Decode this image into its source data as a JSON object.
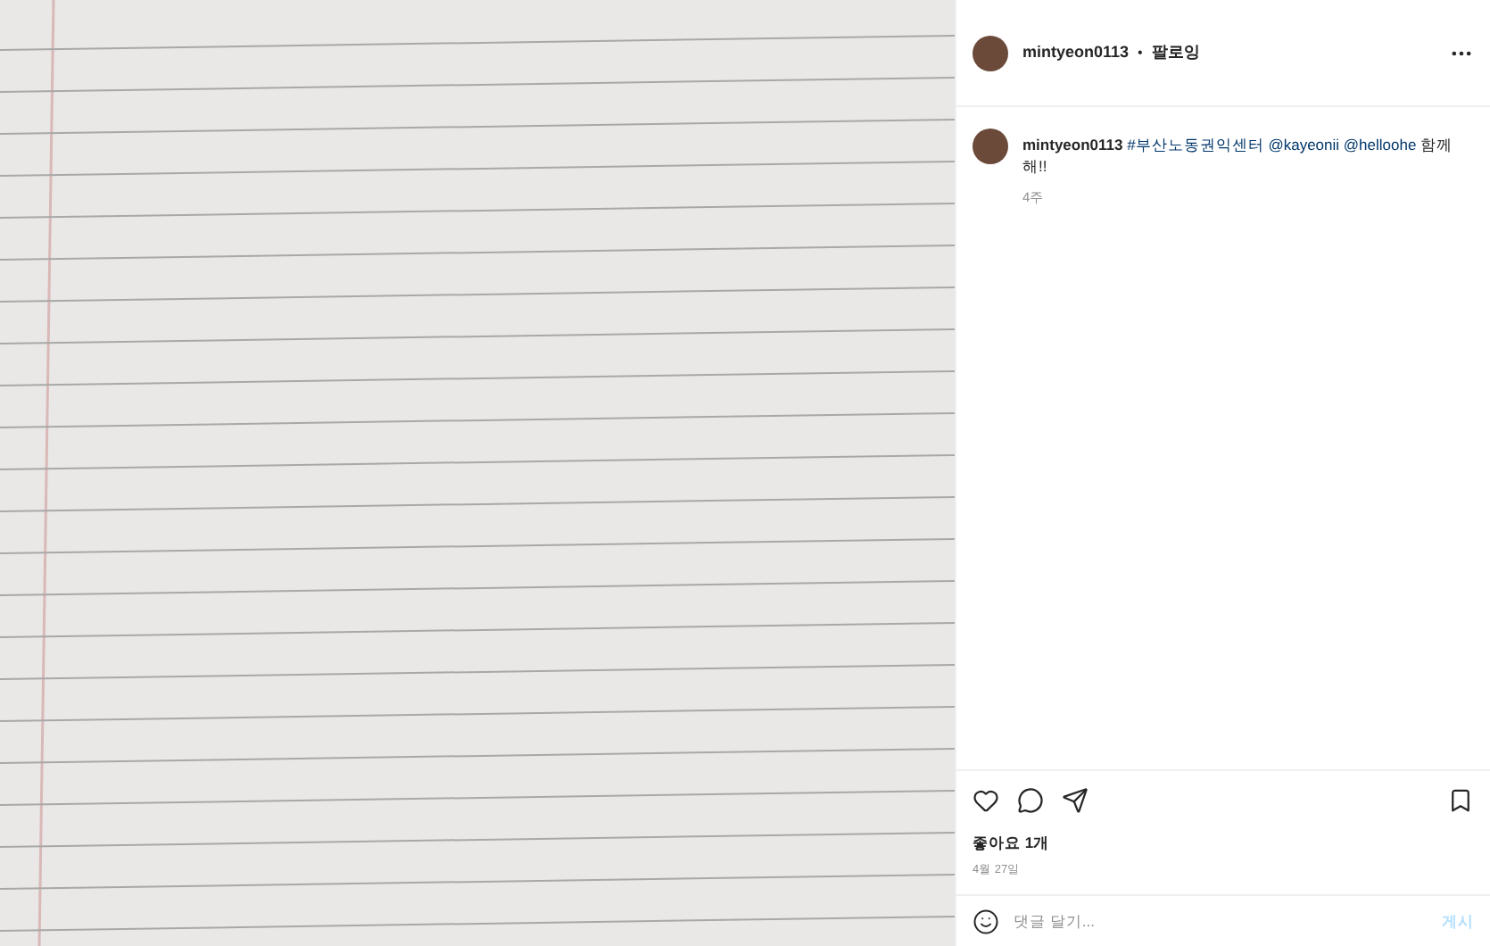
{
  "header": {
    "username": "mintyeon0113",
    "separator": "•",
    "follow": "팔로잉"
  },
  "caption": {
    "username": "mintyeon0113",
    "parts": [
      {
        "kind": "link",
        "text": "#부산노동권익센터"
      },
      {
        "kind": "link",
        "text": "@kayeonii"
      },
      {
        "kind": "link",
        "text": "@helloohe"
      },
      {
        "kind": "text",
        "text": "함께해!!"
      }
    ],
    "time": "4주"
  },
  "likes": "좋아요 1개",
  "date": "4월 27일",
  "comment": {
    "placeholder": "댓글 달기...",
    "post_button": "게시",
    "disabled": true
  }
}
